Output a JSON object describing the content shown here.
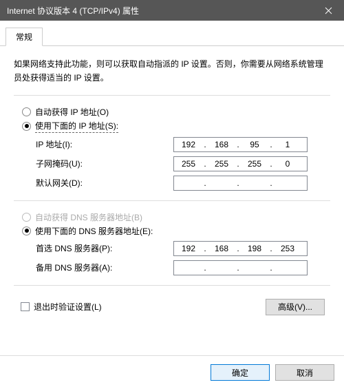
{
  "window": {
    "title": "Internet 协议版本 4 (TCP/IPv4) 属性"
  },
  "tab": {
    "general": "常规"
  },
  "desc": "如果网络支持此功能，则可以获取自动指派的 IP 设置。否则，你需要从网络系统管理员处获得适当的 IP 设置。",
  "ip": {
    "auto_label": "自动获得 IP 地址(O)",
    "manual_label": "使用下面的 IP 地址(S):",
    "address_label": "IP 地址(I):",
    "mask_label": "子网掩码(U):",
    "gateway_label": "默认网关(D):",
    "address": {
      "o1": "192",
      "o2": "168",
      "o3": "95",
      "o4": "1"
    },
    "mask": {
      "o1": "255",
      "o2": "255",
      "o3": "255",
      "o4": "0"
    },
    "gateway": {
      "o1": "",
      "o2": "",
      "o3": "",
      "o4": ""
    }
  },
  "dns": {
    "auto_label": "自动获得 DNS 服务器地址(B)",
    "manual_label": "使用下面的 DNS 服务器地址(E):",
    "primary_label": "首选 DNS 服务器(P):",
    "alternate_label": "备用 DNS 服务器(A):",
    "primary": {
      "o1": "192",
      "o2": "168",
      "o3": "198",
      "o4": "253"
    },
    "alternate": {
      "o1": "",
      "o2": "",
      "o3": "",
      "o4": ""
    }
  },
  "validate_label": "退出时验证设置(L)",
  "advanced_label": "高级(V)...",
  "ok_label": "确定",
  "cancel_label": "取消"
}
